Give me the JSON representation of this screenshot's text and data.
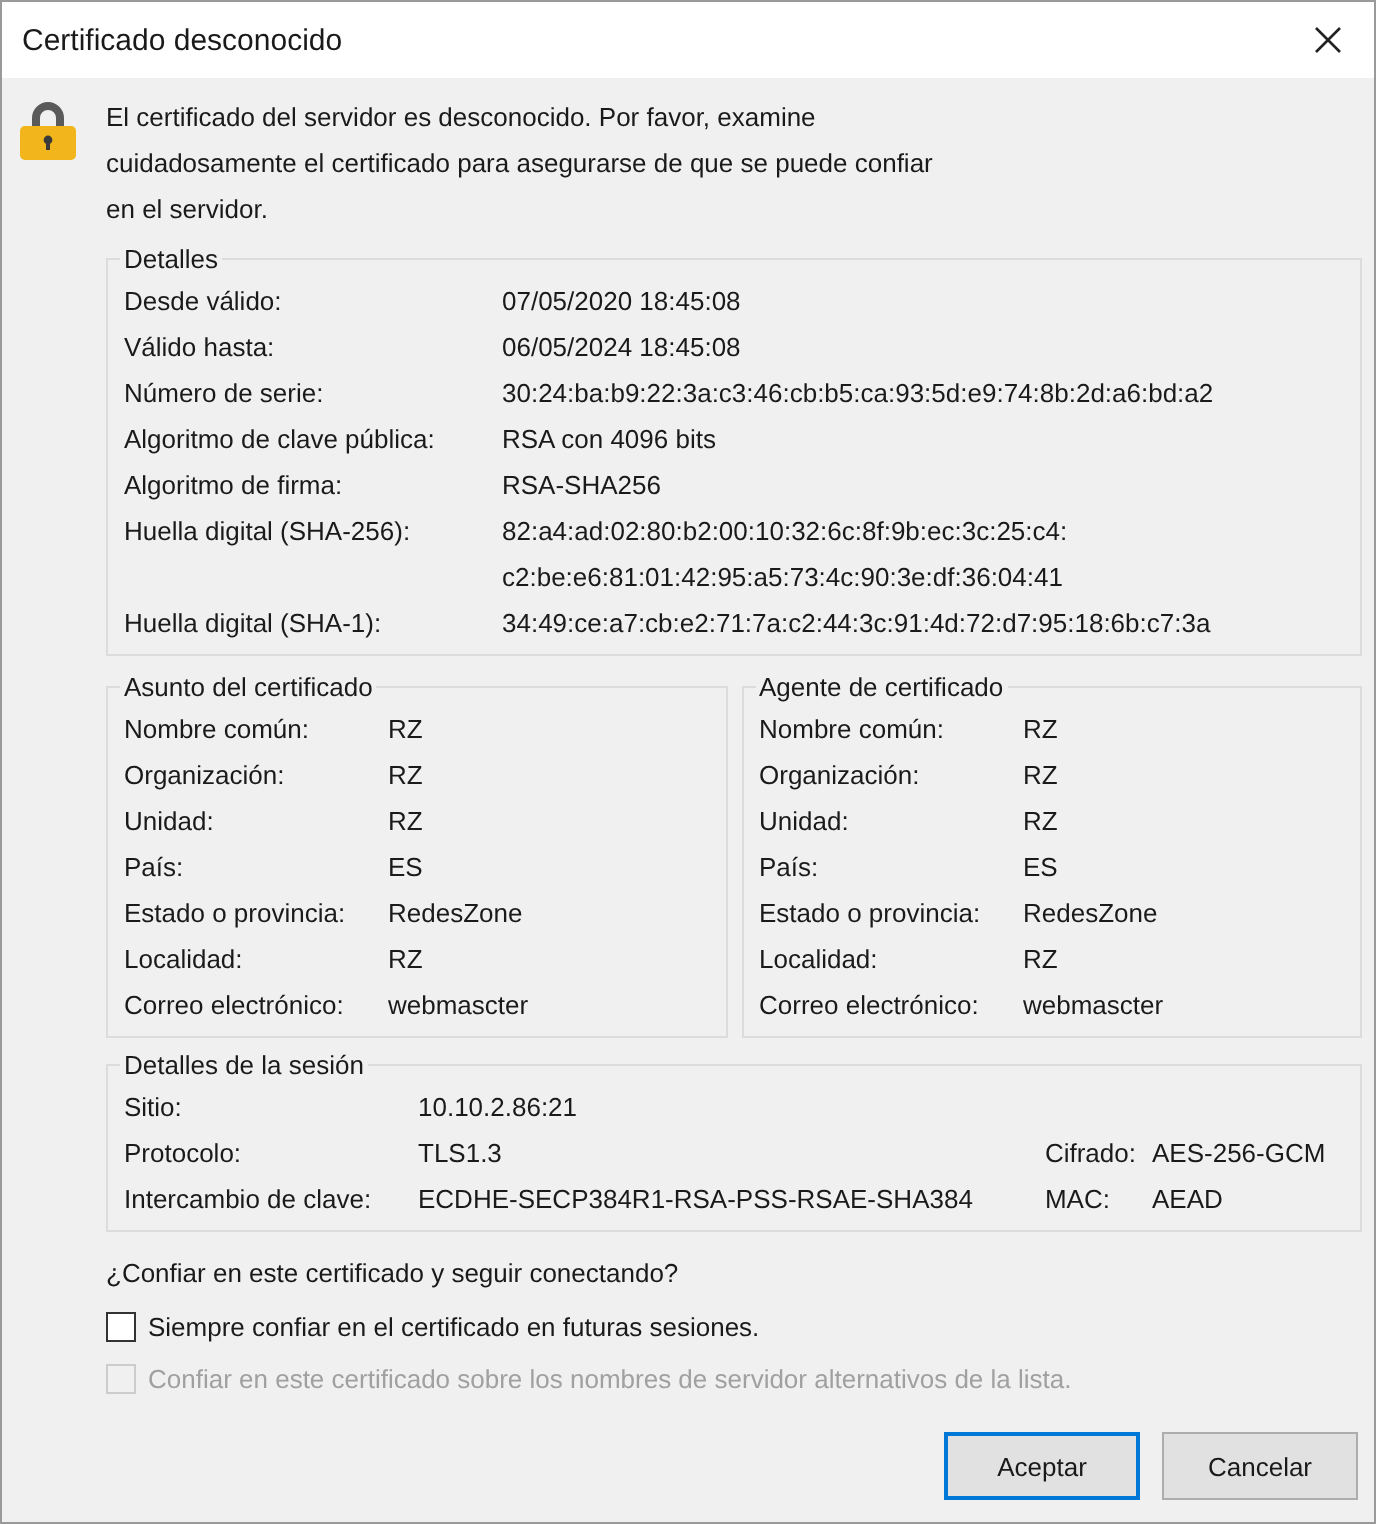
{
  "window": {
    "title": "Certificado desconocido"
  },
  "message": "El certificado del servidor es desconocido. Por favor, examine cuidadosamente el certificado para asegurarse de que se puede confiar en el servidor.",
  "details": {
    "title": "Detalles",
    "rows": [
      {
        "label": "Desde válido:",
        "value": [
          "07/05/2020 18:45:08"
        ]
      },
      {
        "label": "Válido hasta:",
        "value": [
          "06/05/2024 18:45:08"
        ]
      },
      {
        "label": "Número de serie:",
        "value": [
          "30:24:ba:b9:22:3a:c3:46:cb:b5:ca:93:5d:e9:74:8b:2d:a6:bd:a2"
        ]
      },
      {
        "label": "Algoritmo de clave pública:",
        "value": [
          "RSA con 4096 bits"
        ]
      },
      {
        "label": "Algoritmo de firma:",
        "value": [
          "RSA-SHA256"
        ]
      },
      {
        "label": "Huella digital (SHA-256):",
        "value": [
          "82:a4:ad:02:80:b2:00:10:32:6c:8f:9b:ec:3c:25:c4:",
          "c2:be:e6:81:01:42:95:a5:73:4c:90:3e:df:36:04:41"
        ]
      },
      {
        "label": "Huella digital (SHA-1):",
        "value": [
          "34:49:ce:a7:cb:e2:71:7a:c2:44:3c:91:4d:72:d7:95:18:6b:c7:3a"
        ]
      }
    ]
  },
  "subject": {
    "title": "Asunto del certificado",
    "rows": [
      {
        "label": "Nombre común:",
        "value": "RZ"
      },
      {
        "label": "Organización:",
        "value": "RZ"
      },
      {
        "label": "Unidad:",
        "value": "RZ"
      },
      {
        "label": "País:",
        "value": "ES"
      },
      {
        "label": "Estado o provincia:",
        "value": "RedesZone"
      },
      {
        "label": "Localidad:",
        "value": "RZ"
      },
      {
        "label": "Correo electrónico:",
        "value": "webmascter"
      }
    ]
  },
  "issuer": {
    "title": "Agente de certificado",
    "rows": [
      {
        "label": "Nombre común:",
        "value": "RZ"
      },
      {
        "label": "Organización:",
        "value": "RZ"
      },
      {
        "label": "Unidad:",
        "value": "RZ"
      },
      {
        "label": "País:",
        "value": "ES"
      },
      {
        "label": "Estado o provincia:",
        "value": "RedesZone"
      },
      {
        "label": "Localidad:",
        "value": "RZ"
      },
      {
        "label": "Correo electrónico:",
        "value": "webmascter"
      }
    ]
  },
  "session": {
    "title": "Detalles de la sesión",
    "rows": [
      {
        "label": "Sitio:",
        "value": "10.10.2.86:21"
      },
      {
        "label": "Protocolo:",
        "value": "TLS1.3",
        "side_label": "Cifrado:",
        "side_value": "AES-256-GCM"
      },
      {
        "label": "Intercambio de clave:",
        "value": "ECDHE-SECP384R1-RSA-PSS-RSAE-SHA384",
        "side_label": "MAC:",
        "side_value": "AEAD"
      }
    ]
  },
  "question": "¿Confiar en este certificado y seguir conectando?",
  "options": [
    {
      "label": "Siempre confiar en el certificado en futuras sesiones.",
      "checked": false,
      "disabled": false
    },
    {
      "label": "Confiar en este certificado sobre los nombres de servidor alternativos de la lista.",
      "checked": false,
      "disabled": true
    }
  ],
  "buttons": [
    {
      "label": "Aceptar",
      "default": true
    },
    {
      "label": "Cancelar",
      "default": false
    }
  ]
}
